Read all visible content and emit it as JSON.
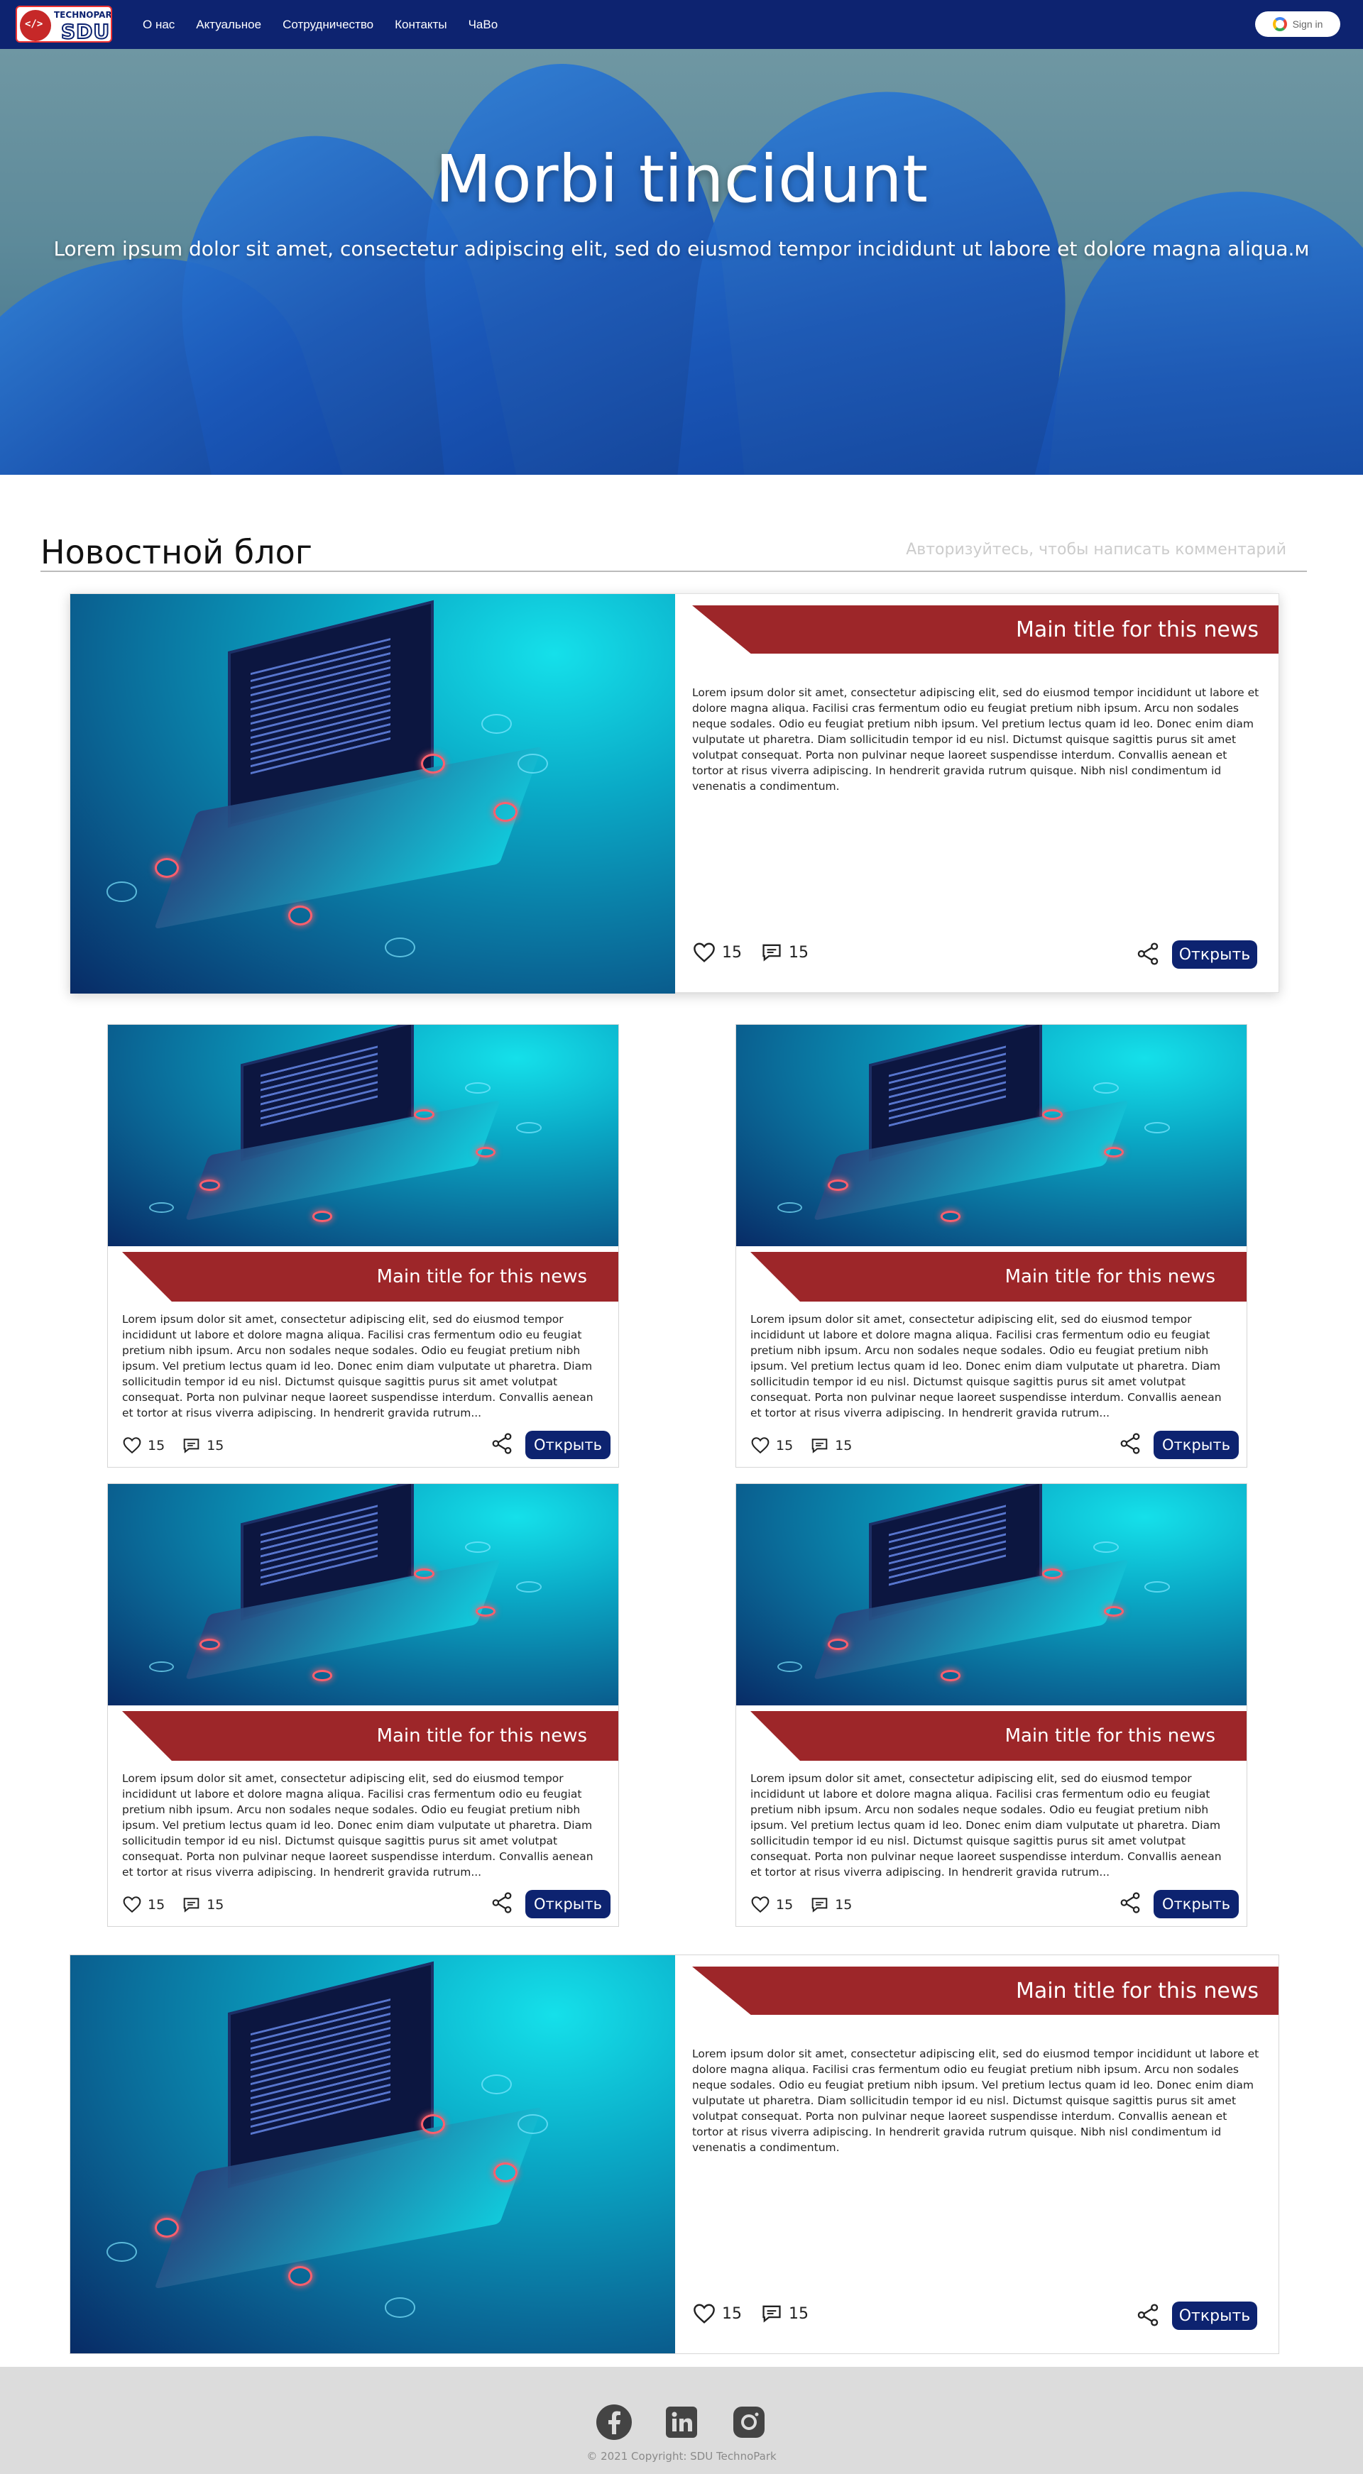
{
  "header": {
    "logo_text_top": "TECHNOPARK",
    "logo_text_main": "SDU",
    "nav": [
      "О нас",
      "Актуальное",
      "Сотрудничество",
      "Контакты",
      "ЧаВо"
    ],
    "signin_label": "Sign in"
  },
  "hero": {
    "title": "Morbi tincidunt",
    "subtitle": "Lorem ipsum dolor sit amet, consectetur adipiscing elit, sed do eiusmod tempor incididunt ut labore et dolore magna aliqua.м"
  },
  "blog": {
    "title": "Новостной блог",
    "auth_hint": "Авторизуйтесь, чтобы написать комментарий"
  },
  "cards": [
    {
      "title": "Main title for this news",
      "body": "Lorem ipsum dolor sit amet, consectetur adipiscing elit, sed do eiusmod tempor incididunt ut labore et dolore magna aliqua. Facilisi cras fermentum odio eu feugiat pretium nibh ipsum. Arcu non sodales neque sodales. Odio eu feugiat pretium nibh ipsum. Vel pretium lectus quam id leo. Donec enim diam vulputate ut pharetra. Diam sollicitudin tempor id eu nisl. Dictumst quisque sagittis purus sit amet volutpat consequat. Porta non pulvinar neque laoreet suspendisse interdum. Convallis aenean et tortor at risus viverra adipiscing. In hendrerit gravida rutrum quisque. Nibh nisl condimentum id venenatis a condimentum.",
      "likes": "15",
      "comments": "15",
      "open_label": "Открыть"
    },
    {
      "title": "Main title for this news",
      "body": "Lorem ipsum dolor sit amet, consectetur adipiscing elit, sed do eiusmod tempor incididunt ut labore et dolore magna aliqua. Facilisi cras fermentum odio eu feugiat pretium nibh ipsum. Arcu non sodales neque sodales. Odio eu feugiat pretium nibh ipsum. Vel pretium lectus quam id leo. Donec enim diam vulputate ut pharetra. Diam sollicitudin tempor id eu nisl. Dictumst quisque sagittis purus sit amet volutpat consequat. Porta non pulvinar neque laoreet suspendisse interdum. Convallis aenean et tortor at risus viverra adipiscing. In hendrerit gravida rutrum...",
      "likes": "15",
      "comments": "15",
      "open_label": "Открыть"
    },
    {
      "title": "Main title for this news",
      "body": "Lorem ipsum dolor sit amet, consectetur adipiscing elit, sed do eiusmod tempor incididunt ut labore et dolore magna aliqua. Facilisi cras fermentum odio eu feugiat pretium nibh ipsum. Arcu non sodales neque sodales. Odio eu feugiat pretium nibh ipsum. Vel pretium lectus quam id leo. Donec enim diam vulputate ut pharetra. Diam sollicitudin tempor id eu nisl. Dictumst quisque sagittis purus sit amet volutpat consequat. Porta non pulvinar neque laoreet suspendisse interdum. Convallis aenean et tortor at risus viverra adipiscing. In hendrerit gravida rutrum...",
      "likes": "15",
      "comments": "15",
      "open_label": "Открыть"
    },
    {
      "title": "Main title for this news",
      "body": "Lorem ipsum dolor sit amet, consectetur adipiscing elit, sed do eiusmod tempor incididunt ut labore et dolore magna aliqua. Facilisi cras fermentum odio eu feugiat pretium nibh ipsum. Arcu non sodales neque sodales. Odio eu feugiat pretium nibh ipsum. Vel pretium lectus quam id leo. Donec enim diam vulputate ut pharetra. Diam sollicitudin tempor id eu nisl. Dictumst quisque sagittis purus sit amet volutpat consequat. Porta non pulvinar neque laoreet suspendisse interdum. Convallis aenean et tortor at risus viverra adipiscing. In hendrerit gravida rutrum...",
      "likes": "15",
      "comments": "15",
      "open_label": "Открыть"
    },
    {
      "title": "Main title for this news",
      "body": "Lorem ipsum dolor sit amet, consectetur adipiscing elit, sed do eiusmod tempor incididunt ut labore et dolore magna aliqua. Facilisi cras fermentum odio eu feugiat pretium nibh ipsum. Arcu non sodales neque sodales. Odio eu feugiat pretium nibh ipsum. Vel pretium lectus quam id leo. Donec enim diam vulputate ut pharetra. Diam sollicitudin tempor id eu nisl. Dictumst quisque sagittis purus sit amet volutpat consequat. Porta non pulvinar neque laoreet suspendisse interdum. Convallis aenean et tortor at risus viverra adipiscing. In hendrerit gravida rutrum...",
      "likes": "15",
      "comments": "15",
      "open_label": "Открыть"
    },
    {
      "title": "Main title for this news",
      "body": "Lorem ipsum dolor sit amet, consectetur adipiscing elit, sed do eiusmod tempor incididunt ut labore et dolore magna aliqua. Facilisi cras fermentum odio eu feugiat pretium nibh ipsum. Arcu non sodales neque sodales. Odio eu feugiat pretium nibh ipsum. Vel pretium lectus quam id leo. Donec enim diam vulputate ut pharetra. Diam sollicitudin tempor id eu nisl. Dictumst quisque sagittis purus sit amet volutpat consequat. Porta non pulvinar neque laoreet suspendisse interdum. Convallis aenean et tortor at risus viverra adipiscing. In hendrerit gravida rutrum quisque. Nibh nisl condimentum id venenatis a condimentum.",
      "likes": "15",
      "comments": "15",
      "open_label": "Открыть"
    }
  ],
  "footer": {
    "social": [
      "facebook-icon",
      "linkedin-icon",
      "instagram-icon"
    ],
    "copyright": "© 2021 Copyright: SDU TechnoPark"
  },
  "colors": {
    "navbar": "#0d2370",
    "ribbon": "#9d2629",
    "button": "#0d2370",
    "footer": "#dcdcdc"
  }
}
